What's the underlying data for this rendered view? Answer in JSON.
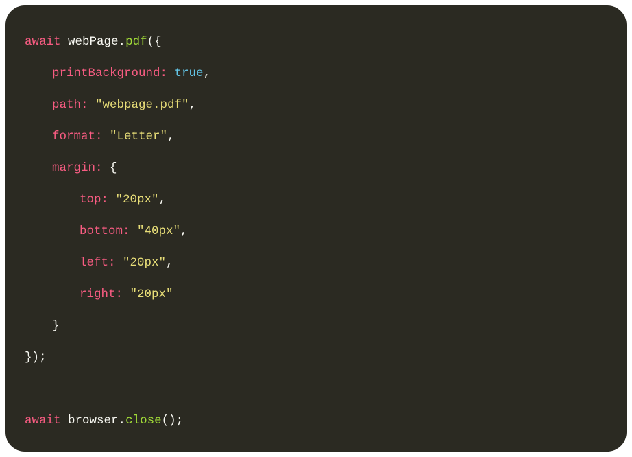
{
  "keywords": {
    "await": "await"
  },
  "vars": {
    "webPage": "webPage",
    "browser": "browser"
  },
  "methods": {
    "pdf": "pdf",
    "close": "close"
  },
  "props": {
    "printBackground": "printBackground",
    "path": "path",
    "format": "format",
    "margin": "margin",
    "top": "top",
    "bottom": "bottom",
    "left": "left",
    "right": "right"
  },
  "values": {
    "true": "true",
    "pathStr": "\"webpage.pdf\"",
    "formatStr": "\"Letter\"",
    "topStr": "\"20px\"",
    "bottomStr": "\"40px\"",
    "leftStr": "\"20px\"",
    "rightStr": "\"20px\""
  },
  "punct": {
    "dot": ".",
    "openParenBrace": "({",
    "closeBraceParenSemi": "});",
    "openParen": "(",
    "closeParenSemi": "();",
    "openBrace": "{",
    "closeBrace": "}",
    "colon": ": ",
    "comma": ",",
    "space": " "
  }
}
